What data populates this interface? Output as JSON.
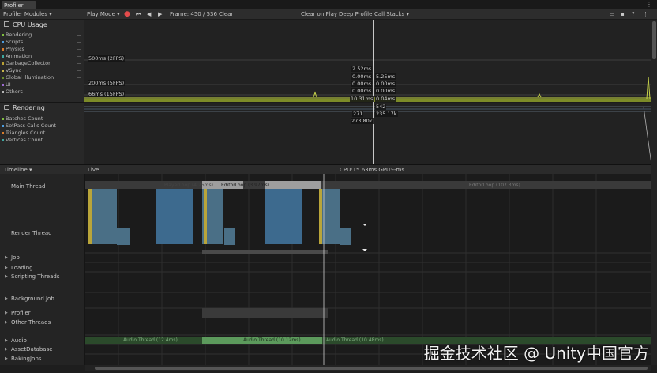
{
  "window": {
    "tab_title": "Profiler"
  },
  "toolbar": {
    "modules": "Profiler Modules",
    "play_mode": "Play Mode",
    "frame": "Frame: 450 / 536",
    "clear": "Clear",
    "clear_on_play": "Clear on Play",
    "deep_profile": "Deep Profile",
    "call_stacks": "Call Stacks"
  },
  "cpu_module": {
    "title": "CPU Usage",
    "legend": [
      {
        "label": "Rendering",
        "color": "#7fbf3f"
      },
      {
        "label": "Scripts",
        "color": "#4d9de0"
      },
      {
        "label": "Physics",
        "color": "#d97c2b"
      },
      {
        "label": "Animation",
        "color": "#3fa7a0"
      },
      {
        "label": "GarbageCollector",
        "color": "#b8a034"
      },
      {
        "label": "VSync",
        "color": "#c9b54a"
      },
      {
        "label": "Global Illumination",
        "color": "#6a8f2f"
      },
      {
        "label": "UI",
        "color": "#9c6bd1"
      },
      {
        "label": "Others",
        "color": "#b5b5b5"
      }
    ],
    "fps_lines": [
      "500ms (2FPS)",
      "200ms (5FPS)",
      "66ms (15FPS)"
    ],
    "selection_values": [
      "2.52ms",
      "0.00ms",
      "5.25ms",
      "0.00ms",
      "0.00ms",
      "0.00ms",
      "0.00ms",
      "10.31ms",
      "0.04ms"
    ]
  },
  "rendering_module": {
    "title": "Rendering",
    "legend": [
      {
        "label": "Batches Count",
        "color": "#7fbf3f"
      },
      {
        "label": "SetPass Calls Count",
        "color": "#4d9de0"
      },
      {
        "label": "Triangles Count",
        "color": "#d97c2b"
      },
      {
        "label": "Vertices Count",
        "color": "#3fa7a0"
      }
    ],
    "selection_values": [
      "542",
      "271",
      "235.17k",
      "273.80k"
    ]
  },
  "timeline": {
    "view": "Timeline",
    "live": "Live",
    "cpu_gpu": "CPU:15.63ms   GPU:--ms",
    "threads": [
      {
        "label": "Main Thread",
        "arrow": false
      },
      {
        "label": "Render Thread",
        "arrow": false
      },
      {
        "label": "Job",
        "arrow": true
      },
      {
        "label": "Loading",
        "arrow": true
      },
      {
        "label": "Scripting Threads",
        "arrow": true
      },
      {
        "label": "Background Job",
        "arrow": true
      },
      {
        "label": "Profiler",
        "arrow": true
      },
      {
        "label": "Other Threads",
        "arrow": true
      },
      {
        "label": "Audio",
        "arrow": true
      },
      {
        "label": "AssetDatabase",
        "arrow": true
      },
      {
        "label": "BakingJobs",
        "arrow": true
      }
    ],
    "markers": [
      {
        "text": "EditorLoop (3.97ms)",
        "color": "#9e9e9e"
      },
      {
        "text": "EditorLoop (107.3ms)",
        "color": "#6a6a6a"
      },
      {
        "text": "PlayerLoop (4.75ms)",
        "color": "#9e9e9e"
      },
      {
        "text": "Audio Thread (10.12ms)",
        "color": "#9dd79d"
      },
      {
        "text": "Audio Thread (12.4ms)",
        "color": "#7fae7f"
      },
      {
        "text": "Audio Thread (10.48ms)",
        "color": "#7fae7f"
      }
    ]
  },
  "watermark": "掘金技术社区 @ Unity中国官方"
}
